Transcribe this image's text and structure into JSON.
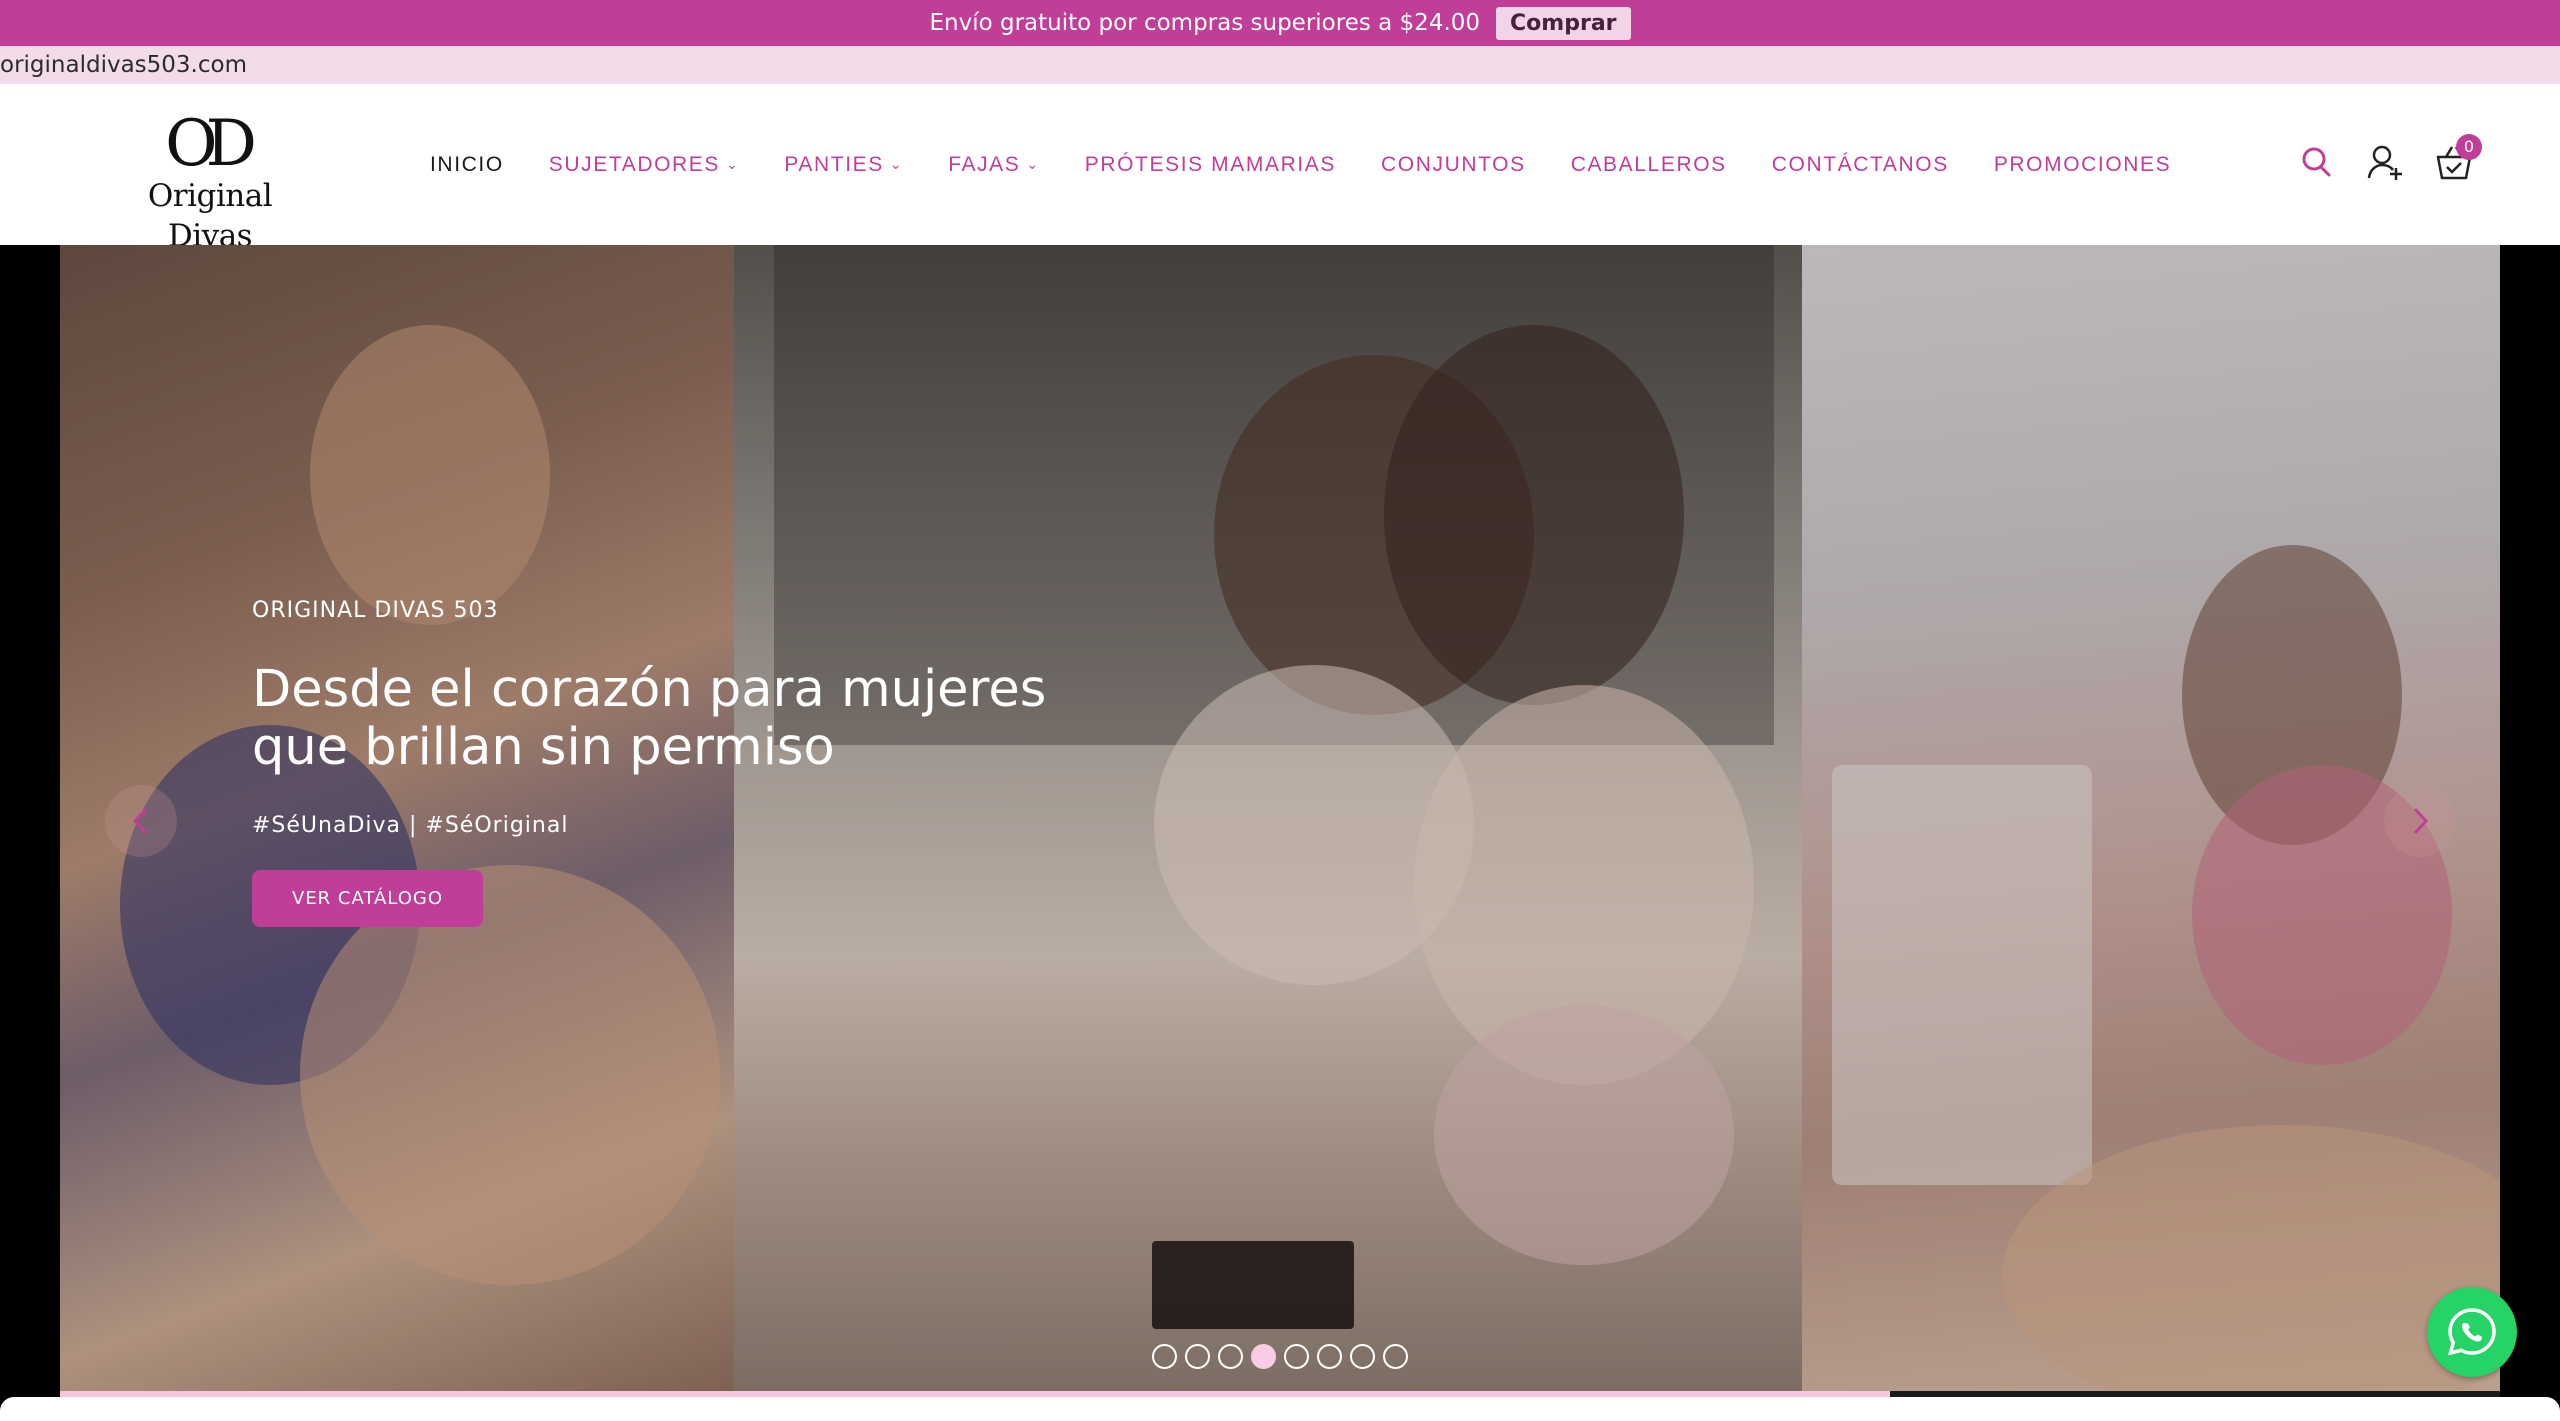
{
  "announcement": {
    "text": "Envío gratuito por compras superiores a $24.00",
    "button_label": "Comprar",
    "bg_color": "#c03e98"
  },
  "domain_label": "originaldivas503.com",
  "header": {
    "logo_monogram": "OD",
    "logo_name": "Original Divas",
    "nav": [
      {
        "label": "INICIO",
        "active": true,
        "dropdown": false
      },
      {
        "label": "SUJETADORES",
        "active": false,
        "dropdown": true
      },
      {
        "label": "PANTIES",
        "active": false,
        "dropdown": true
      },
      {
        "label": "FAJAS",
        "active": false,
        "dropdown": true
      },
      {
        "label": "PRÓTESIS MAMARIAS",
        "active": false,
        "dropdown": false
      },
      {
        "label": "CONJUNTOS",
        "active": false,
        "dropdown": false
      },
      {
        "label": "CABALLEROS",
        "active": false,
        "dropdown": false
      },
      {
        "label": "CONTÁCTANOS",
        "active": false,
        "dropdown": false
      },
      {
        "label": "PROMOCIONES",
        "active": false,
        "dropdown": false
      }
    ],
    "icons": [
      "search-icon",
      "account-icon",
      "cart-icon"
    ],
    "cart_count": "0"
  },
  "hero": {
    "kicker": "ORIGINAL DIVAS 503",
    "title": "Desde el corazón para mujeres que brillan sin permiso",
    "tags": "#SéUnaDiva | #SéOriginal",
    "cta_label": "VER CATÁLOGO",
    "slide_count": 8,
    "active_slide": 4,
    "progress": 0.75
  },
  "colors": {
    "brand": "#c03e98",
    "brand_light": "#f3dcea",
    "whatsapp": "#25d366"
  }
}
